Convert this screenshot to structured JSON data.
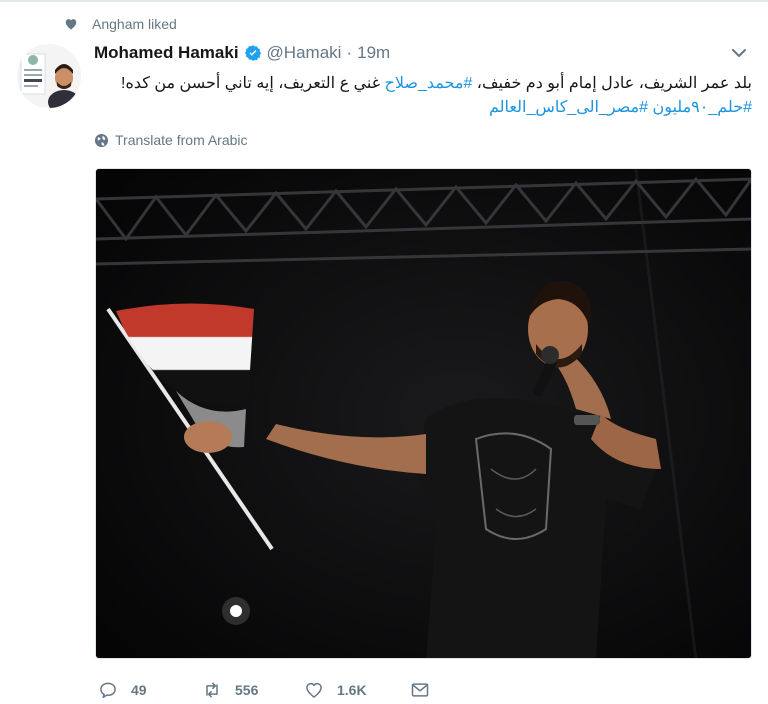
{
  "context": {
    "text": "Angham liked",
    "icon": "heart-icon"
  },
  "tweet": {
    "name": "Mohamed Hamaki",
    "handle": "@Hamaki",
    "separator": "·",
    "time": "19m",
    "verified": true,
    "text_line1_part1": "بلد عمر الشريف، عادل إمام أبو دم خفيف، ",
    "hashtag1": "#محمد_صلاح",
    "text_line1_part2": " غني ع التعريف، إيه تاني أحسن من كده!",
    "hashtag_line2": "#حلم_٩٠مليون #مصر_الى_كاس_العالم",
    "translate_label": "Translate from Arabic"
  },
  "actions": {
    "reply_count": "49",
    "retweet_count": "556",
    "like_count": "1.6K"
  },
  "colors": {
    "text": "#14171a",
    "muted": "#657786",
    "link": "#1b95e0",
    "verified": "#1da1f2"
  }
}
